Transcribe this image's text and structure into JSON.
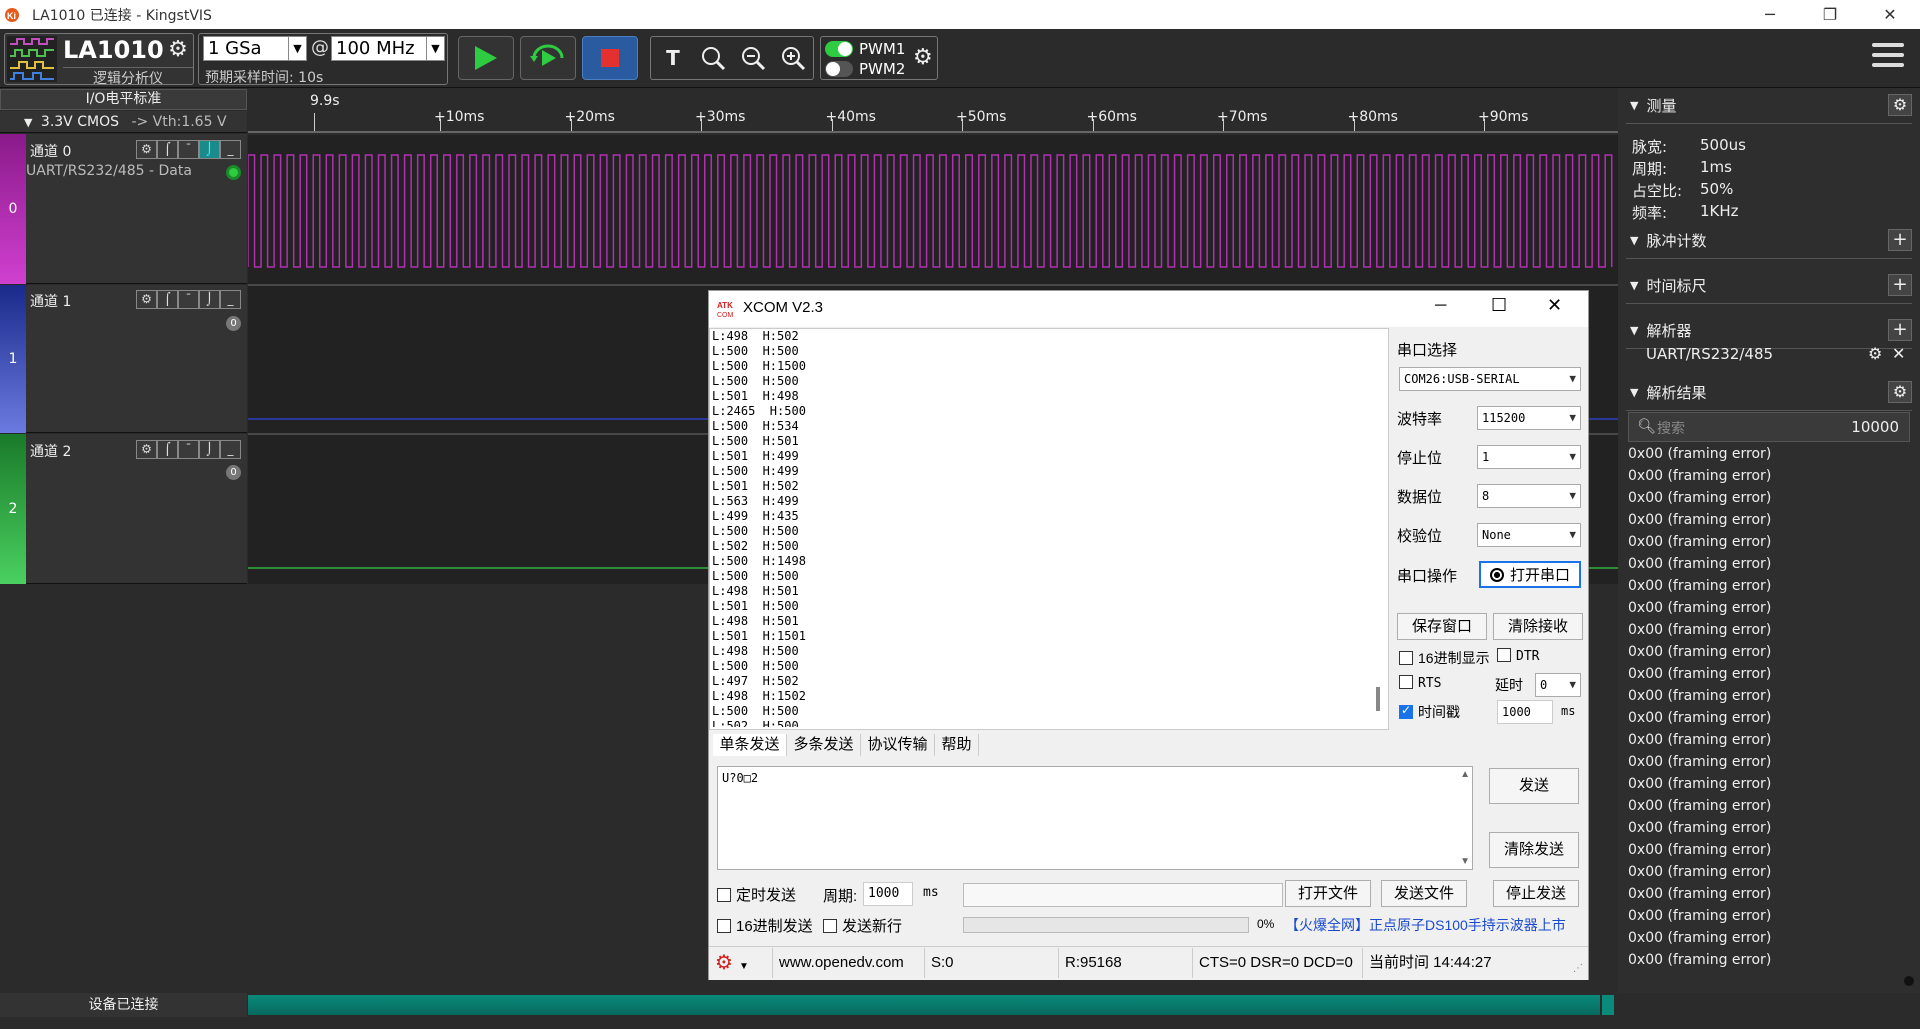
{
  "window": {
    "title": "LA1010 已连接 - KingstVIS"
  },
  "toolbar": {
    "device_name": "LA1010",
    "device_sub": "逻辑分析仪",
    "sample_depth": "1 GSa",
    "at": "@",
    "sample_rate": "100 MHz",
    "expected_time": "预期采样时间: 10s",
    "pwm1": "PWM1",
    "pwm2": "PWM2"
  },
  "io": {
    "header": "I/O电平标准",
    "standard": "3.3V CMOS",
    "vth": "-> Vth:1.65 V"
  },
  "timeline": {
    "start": "9.9s",
    "ticks": [
      "+10ms",
      "+20ms",
      "+30ms",
      "+40ms",
      "+50ms",
      "+60ms",
      "+70ms",
      "+80ms",
      "+90ms"
    ]
  },
  "channels": [
    {
      "name": "通道 0",
      "index": "0",
      "decoder": "UART/RS232/485 - Data",
      "badge": "",
      "color": "#b030b0"
    },
    {
      "name": "通道 1",
      "index": "1",
      "decoder": "",
      "badge": "0",
      "color": "#3040c0"
    },
    {
      "name": "通道 2",
      "index": "2",
      "decoder": "",
      "badge": "0",
      "color": "#30b040"
    }
  ],
  "measure": {
    "title": "测量",
    "rows": [
      {
        "label": "脉宽:",
        "value": "500us"
      },
      {
        "label": "周期:",
        "value": "1ms"
      },
      {
        "label": "占空比:",
        "value": "50%"
      },
      {
        "label": "频率:",
        "value": "1KHz"
      }
    ]
  },
  "sections": {
    "pulse": "脉冲计数",
    "timer": "时间标尺",
    "analyzer": "解析器",
    "results": "解析结果"
  },
  "analyzer_item": "UART/RS232/485",
  "search": {
    "placeholder": "搜索",
    "count": "10000"
  },
  "results": [
    "0x00 (framing error)",
    "0x00 (framing error)",
    "0x00 (framing error)",
    "0x00 (framing error)",
    "0x00 (framing error)",
    "0x00 (framing error)",
    "0x00 (framing error)",
    "0x00 (framing error)",
    "0x00 (framing error)",
    "0x00 (framing error)",
    "0x00 (framing error)",
    "0x00 (framing error)",
    "0x00 (framing error)",
    "0x00 (framing error)",
    "0x00 (framing error)",
    "0x00 (framing error)",
    "0x00 (framing error)",
    "0x00 (framing error)",
    "0x00 (framing error)",
    "0x00 (framing error)",
    "0x00 (framing error)",
    "0x00 (framing error)",
    "0x00 (framing error)",
    "0x00 (framing error)"
  ],
  "status_bar": {
    "device": "设备已连接"
  },
  "xcom": {
    "title": "XCOM V2.3",
    "logo": "ATK XCOM",
    "rx_lines": [
      "L:498  H:502",
      "L:500  H:500",
      "L:500  H:1500",
      "L:500  H:500",
      "L:501  H:498",
      "L:2465  H:500",
      "L:500  H:534",
      "L:500  H:501",
      "L:501  H:499",
      "L:500  H:499",
      "L:501  H:502",
      "L:563  H:499",
      "L:499  H:435",
      "L:500  H:500",
      "L:502  H:500",
      "L:500  H:1498",
      "L:500  H:500",
      "L:498  H:501",
      "L:501  H:500",
      "L:498  H:501",
      "L:501  H:1501",
      "L:498  H:500",
      "L:500  H:500",
      "L:497  H:502",
      "L:498  H:1502",
      "L:500  H:500",
      "L:502  H:500"
    ],
    "port_label": "串口选择",
    "port_value": "COM26:USB-SERIAL",
    "baud_label": "波特率",
    "baud_value": "115200",
    "stop_label": "停止位",
    "stop_value": "1",
    "data_label": "数据位",
    "data_value": "8",
    "parity_label": "校验位",
    "parity_value": "None",
    "op_label": "串口操作",
    "open_button": "打开串口",
    "save_window": "保存窗口",
    "clear_rx": "清除接收",
    "hex_display": "16进制显示",
    "dtr": "DTR",
    "rts": "RTS",
    "delay_label": "延时",
    "delay_value": "0",
    "timestamp": "时间戳",
    "timestamp_value": "1000",
    "ms": "ms",
    "tabs": [
      "单条发送",
      "多条发送",
      "协议传输",
      "帮助"
    ],
    "tx_text": "U?0□2",
    "send": "发送",
    "clear_send": "清除发送",
    "timed_send": "定时发送",
    "period_label": "周期:",
    "period_value": "1000",
    "open_file": "打开文件",
    "send_file": "发送文件",
    "stop_send": "停止发送",
    "hex_send": "16进制发送",
    "send_newline": "发送新行",
    "progress": "0%",
    "ad": "【火爆全网】正点原子DS100手持示波器上市",
    "website": "www.openedv.com",
    "sent": "S:0",
    "received": "R:95168",
    "lines": "CTS=0 DSR=0 DCD=0",
    "time": "当前时间 14:44:27"
  }
}
